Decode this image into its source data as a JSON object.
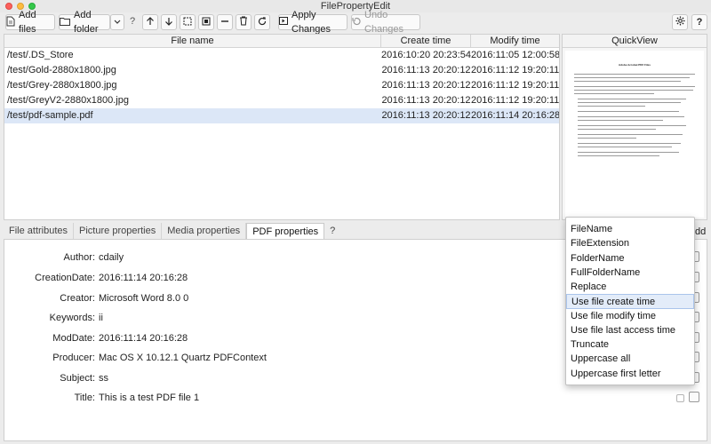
{
  "window": {
    "title": "FilePropertyEdit"
  },
  "toolbar": {
    "add_files": "Add files",
    "add_folder": "Add folder",
    "help": "?",
    "apply": "Apply Changes",
    "undo": "Undo Changes",
    "icons": [
      "add-files-icon",
      "add-folder-icon",
      "dropdown-icon",
      "up-arrow-icon",
      "down-arrow-icon",
      "select-icon",
      "select-all-icon",
      "remove-icon",
      "trash-icon",
      "refresh-icon",
      "apply-icon",
      "undo-icon",
      "settings-icon",
      "help-icon"
    ]
  },
  "table": {
    "headers": [
      "File name",
      "Create time",
      "Modify time"
    ],
    "rows": [
      {
        "name": "/test/.DS_Store",
        "create": "2016:10:20 20:23:54",
        "modify": "2016:11:05 12:00:58",
        "selected": false
      },
      {
        "name": "/test/Gold-2880x1800.jpg",
        "create": "2016:11:13 20:20:12",
        "modify": "2016:11:12 19:20:11",
        "selected": false
      },
      {
        "name": "/test/Grey-2880x1800.jpg",
        "create": "2016:11:13 20:20:12",
        "modify": "2016:11:12 19:20:11",
        "selected": false
      },
      {
        "name": "/test/GreyV2-2880x1800.jpg",
        "create": "2016:11:13 20:20:12",
        "modify": "2016:11:12 19:20:11",
        "selected": false
      },
      {
        "name": "/test/pdf-sample.pdf",
        "create": "2016:11:13 20:20:12",
        "modify": "2016:11:14 20:16:28",
        "selected": true
      }
    ]
  },
  "quickview": {
    "title": "QuickView",
    "doc_title": "Adobe Acrobat PDF Files"
  },
  "tabs": {
    "items": [
      "File attributes",
      "Picture properties",
      "Media properties",
      "PDF properties"
    ],
    "active": "PDF properties",
    "help": "?"
  },
  "properties": [
    {
      "label": "Author:",
      "value": "cdaily"
    },
    {
      "label": "CreationDate:",
      "value": "2016:11:14 20:16:28"
    },
    {
      "label": "Creator:",
      "value": "Microsoft Word 8.0 0"
    },
    {
      "label": "Keywords:",
      "value": "ii"
    },
    {
      "label": "ModDate:",
      "value": "2016:11:14 20:16:28"
    },
    {
      "label": "Producer:",
      "value": "Mac OS X 10.12.1 Quartz PDFContext"
    },
    {
      "label": "Subject:",
      "value": "ss"
    },
    {
      "label": "Title:",
      "value": "This is a test PDF file 1"
    }
  ],
  "menu": {
    "items": [
      "FileName",
      "FileExtension",
      "FolderName",
      "FullFolderName",
      "Replace",
      "Use file create time",
      "Use file modify time",
      "Use file last access time",
      "Truncate",
      "Uppercase all",
      "Uppercase first letter"
    ],
    "highlighted": "Use file create time"
  },
  "side_label": "dd",
  "colors": {
    "selection": "#dce7f7",
    "menu_highlight": "#e3ecf9"
  }
}
